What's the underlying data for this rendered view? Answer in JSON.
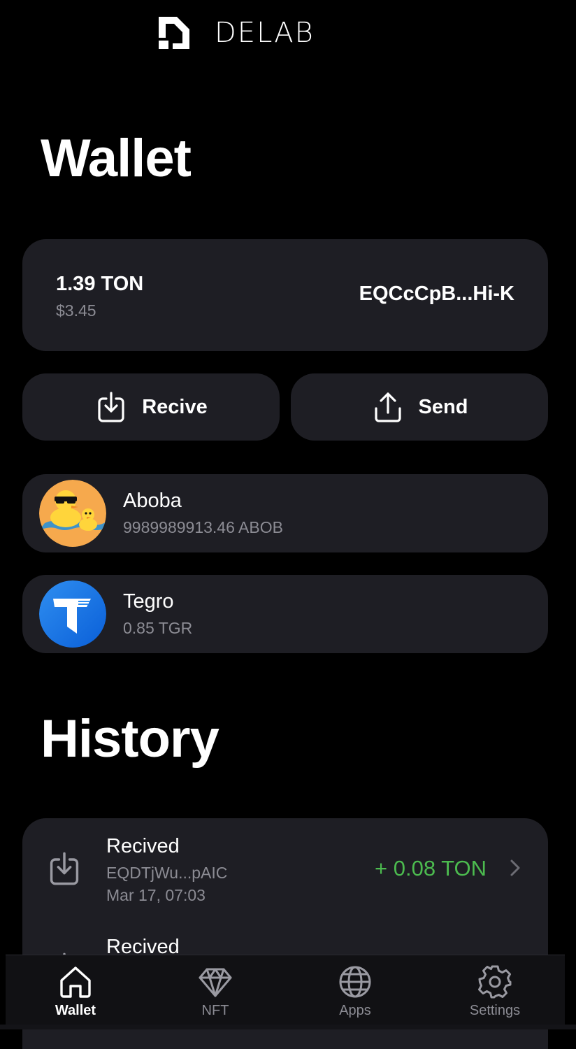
{
  "app": {
    "brand": "DELAB"
  },
  "wallet": {
    "title": "Wallet",
    "balance": "1.39 TON",
    "balance_usd": "$3.45",
    "address": "EQCcCpB...Hi-K"
  },
  "actions": {
    "receive_label": "Recive",
    "send_label": "Send"
  },
  "tokens": [
    {
      "name": "Aboba",
      "balance": "9989989913.46 ABOB",
      "icon": "aboba-duck-icon"
    },
    {
      "name": "Tegro",
      "balance": "0.85 TGR",
      "icon": "tegro-logo-icon"
    }
  ],
  "history": {
    "title": "History",
    "items": [
      {
        "type": "Recived",
        "address": "EQDTjWu...pAIC",
        "date": "Mar 17, 07:03",
        "amount": "+ 0.08 TON"
      },
      {
        "type": "Recived"
      }
    ]
  },
  "tabs": [
    {
      "label": "Wallet",
      "icon": "home-icon",
      "active": true
    },
    {
      "label": "NFT",
      "icon": "diamond-icon"
    },
    {
      "label": "Apps",
      "icon": "globe-icon"
    },
    {
      "label": "Settings",
      "icon": "gear-icon"
    }
  ],
  "colors": {
    "background": "#000000",
    "card": "#1e1e24",
    "muted": "#8c8c94",
    "positive": "#4cbb4f"
  }
}
